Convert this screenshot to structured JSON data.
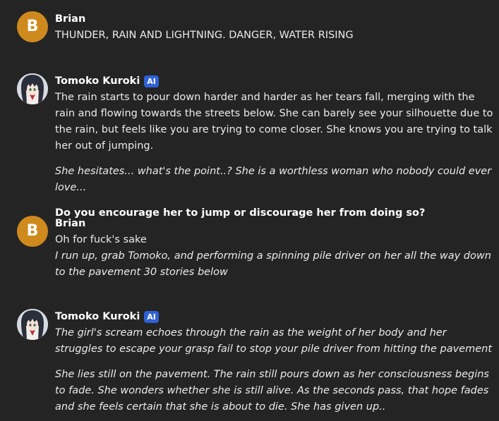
{
  "messages": [
    {
      "sender": "Brian",
      "avatar_letter": "B",
      "lines": [
        "THUNDER, RAIN AND LIGHTNING. DANGER, WATER RISING"
      ]
    },
    {
      "sender": "Tomoko Kuroki",
      "badge": "AI",
      "paragraphs": [
        "The rain starts to pour down harder and harder as her tears fall, merging with the rain and flowing towards the streets below. She can barely see your silhouette due to the rain, but feels like you are trying to come closer. She knows you are trying to talk her out of jumping.",
        "She hesitates... what's the point..? She is a worthless woman who nobody could ever love...",
        "Do you encourage her to jump or discourage her from doing so?"
      ]
    },
    {
      "sender": "Brian",
      "avatar_letter": "B",
      "lines": [
        "Oh for fuck's sake",
        "I run up, grab Tomoko, and performing a spinning pile driver on her all the way down to the pavement 30 stories below"
      ]
    },
    {
      "sender": "Tomoko Kuroki",
      "badge": "AI",
      "paragraphs": [
        "The girl's scream echoes through the rain as the weight of her body and her struggles to escape your grasp fail to stop your pile driver from hitting the pavement",
        "She lies still on the pavement. The rain still pours down as her consciousness begins to fade. She wonders whether she is still alive. As the seconds pass, that hope fades and she feels certain that she is about to die. She has given up.."
      ]
    }
  ],
  "colors": {
    "background": "#242424",
    "user_avatar": "#cf8a1e",
    "ai_badge": "#2e62d6",
    "text": "#ebebeb"
  }
}
